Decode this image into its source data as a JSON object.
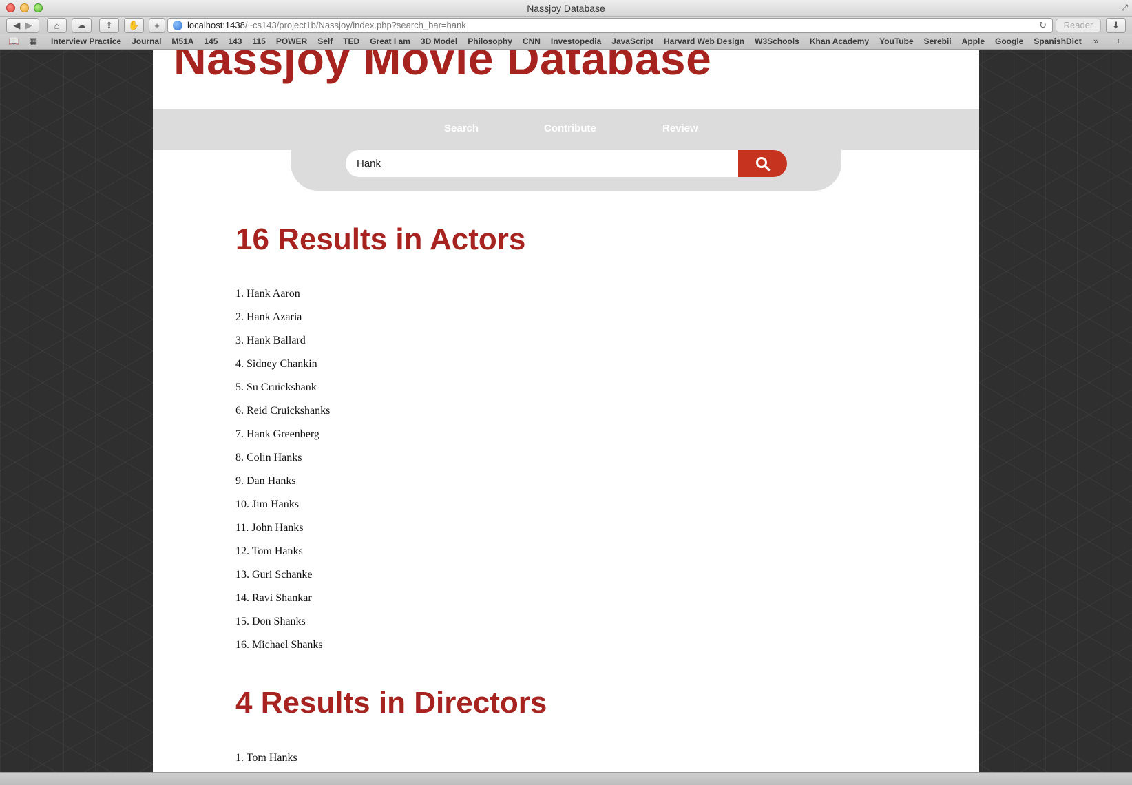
{
  "window": {
    "title": "Nassjoy Database"
  },
  "toolbar": {
    "url_host": "localhost:1438",
    "url_path": "/~cs143/project1b/Nassjoy/index.php?search_bar=hank",
    "reader_label": "Reader"
  },
  "bookmarks": [
    "Interview Practice",
    "Journal",
    "M51A",
    "145",
    "143",
    "115",
    "POWER",
    "Self",
    "TED",
    "Great I am",
    "3D Model",
    "Philosophy",
    "CNN",
    "Investopedia",
    "JavaScript",
    "Harvard Web Design",
    "W3Schools",
    "Khan Academy",
    "YouTube",
    "Serebii",
    "Apple",
    "Google",
    "SpanishDict"
  ],
  "site": {
    "title": "Nassjoy Movie Database",
    "nav": [
      "Search",
      "Contribute",
      "Review"
    ],
    "search_value": "Hank"
  },
  "actors": {
    "heading": "16 Results in Actors",
    "items": [
      "1. Hank Aaron",
      "2. Hank Azaria",
      "3. Hank Ballard",
      "4. Sidney Chankin",
      "5. Su Cruickshank",
      "6. Reid Cruickshanks",
      "7. Hank Greenberg",
      "8. Colin Hanks",
      "9. Dan Hanks",
      "10. Jim Hanks",
      "11. John Hanks",
      "12. Tom Hanks",
      "13. Guri Schanke",
      "14. Ravi Shankar",
      "15. Don Shanks",
      "16. Michael Shanks"
    ]
  },
  "directors": {
    "heading": "4 Results in Directors",
    "items": [
      "1. Tom Hanks"
    ]
  },
  "colors": {
    "brand_red": "#a7231f",
    "search_button": "#c6341f",
    "nav_bg": "#dcdcdc"
  }
}
